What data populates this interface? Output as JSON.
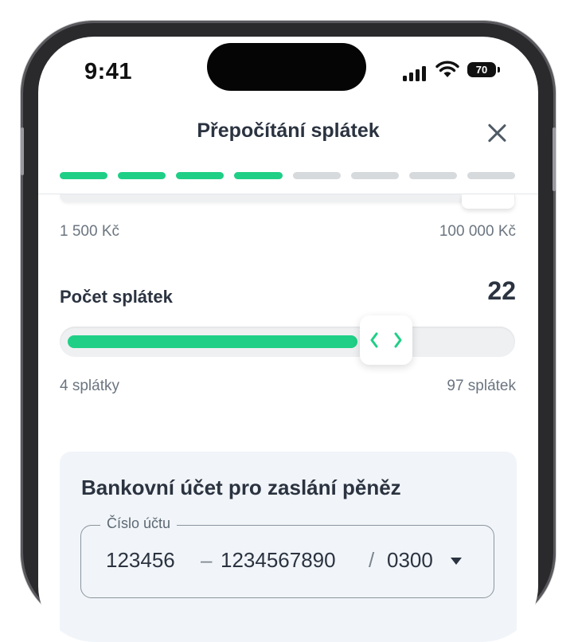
{
  "status": {
    "time": "9:41",
    "battery": "70"
  },
  "header": {
    "title": "Přepočítání splátek"
  },
  "progress": {
    "completed_steps": 4,
    "total_steps": 8
  },
  "amount_range": {
    "min_label": "1 500 Kč",
    "max_label": "100 000 Kč"
  },
  "installments": {
    "label": "Počet splátek",
    "value": "22",
    "min_label": "4 splátky",
    "max_label": "97 splátek",
    "fill_fraction": 0.66
  },
  "bank": {
    "title": "Bankovní účet pro zaslání pěněz",
    "field_label": "Číslo účtu",
    "prefix": "123456",
    "dash": "–",
    "number": "1234567890",
    "slash": "/",
    "bank_code": "0300"
  },
  "colors": {
    "accent": "#1fcf86",
    "text": "#2b3340",
    "track": "#eef0f2",
    "card": "#f1f5f9"
  }
}
